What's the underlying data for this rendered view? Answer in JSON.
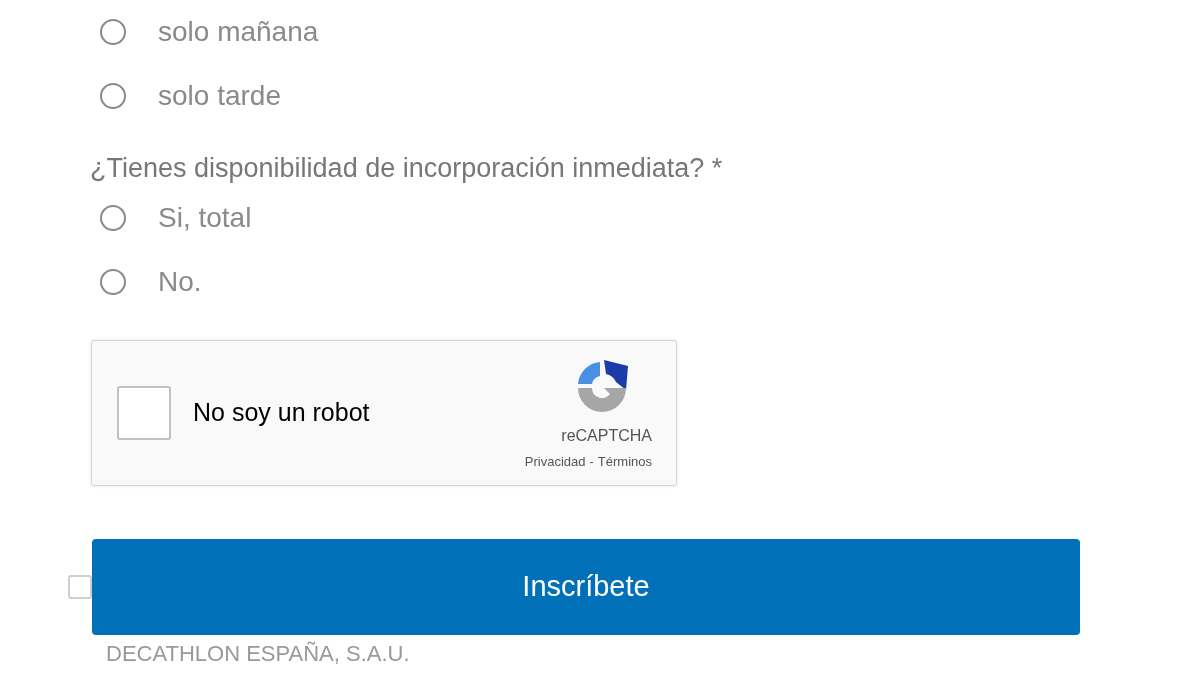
{
  "shift_options": [
    {
      "label": "solo mañana",
      "selected": false
    },
    {
      "label": "solo tarde",
      "selected": false
    }
  ],
  "availability": {
    "question": "¿Tienes disponibilidad de incorporación inmediata? *",
    "options": [
      {
        "label": "Si, total",
        "selected": false
      },
      {
        "label": "No.",
        "selected": false
      }
    ]
  },
  "captcha": {
    "label": "No soy un robot",
    "checked": false,
    "brand": "reCAPTCHA",
    "privacy": "Privacidad",
    "separator": "-",
    "terms": "Términos"
  },
  "consent": {
    "checked": false
  },
  "submit": "Inscríbete",
  "footer": "DECATHLON ESPAÑA, S.A.U."
}
